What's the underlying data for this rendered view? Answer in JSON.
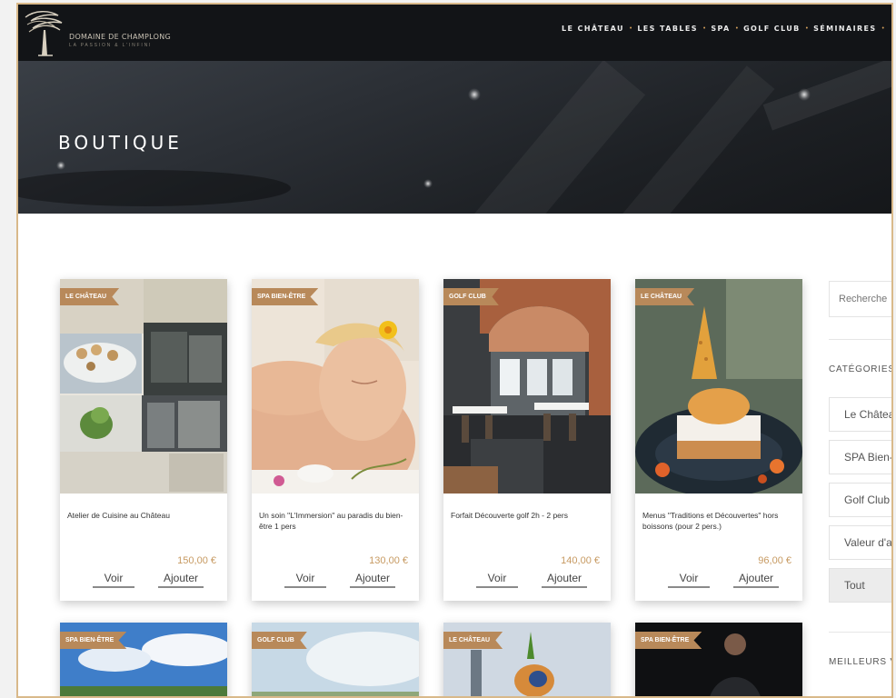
{
  "header": {
    "logo_name": "DOMAINE DE CHAMPLONG",
    "logo_tagline": "LA PASSION & L'INFINI",
    "nav": [
      "LE CHÂTEAU",
      "LES TABLES",
      "SPA",
      "GOLF CLUB",
      "SÉMINAIRES"
    ]
  },
  "hero": {
    "title": "BOUTIQUE"
  },
  "products": [
    {
      "badge": "LE CHÂTEAU",
      "name": "Atelier de Cuisine au Château",
      "price": "150,00 €",
      "view": "Voir",
      "add": "Ajouter"
    },
    {
      "badge": "SPA BIEN-ÊTRE",
      "name": "Un soin \"L'Immersion\" au paradis du bien-être 1 pers",
      "price": "130,00 €",
      "view": "Voir",
      "add": "Ajouter"
    },
    {
      "badge": "GOLF CLUB",
      "name": "Forfait Découverte golf 2h - 2 pers",
      "price": "140,00 €",
      "view": "Voir",
      "add": "Ajouter"
    },
    {
      "badge": "LE CHÂTEAU",
      "name": "Menus \"Traditions et Découvertes\" hors boissons (pour 2 pers.)",
      "price": "96,00 €",
      "view": "Voir",
      "add": "Ajouter"
    }
  ],
  "products_row2": [
    {
      "badge": "SPA BIEN-ÊTRE"
    },
    {
      "badge": "GOLF CLUB"
    },
    {
      "badge": "LE CHÂTEAU"
    },
    {
      "badge": "SPA BIEN-ÊTRE"
    }
  ],
  "sidebar": {
    "search_placeholder": "Recherche",
    "categories_title": "CATÉGORIES",
    "categories": [
      "Le Château",
      "SPA Bien-Être",
      "Golf Club",
      "Valeur d'achat",
      "Tout"
    ],
    "active_category": "Tout",
    "best_title": "MEILLEURS VENTES"
  },
  "colors": {
    "accent": "#b8895a",
    "price": "#c79a62",
    "header_bg": "#121417",
    "frame_border": "#d9b98a"
  }
}
